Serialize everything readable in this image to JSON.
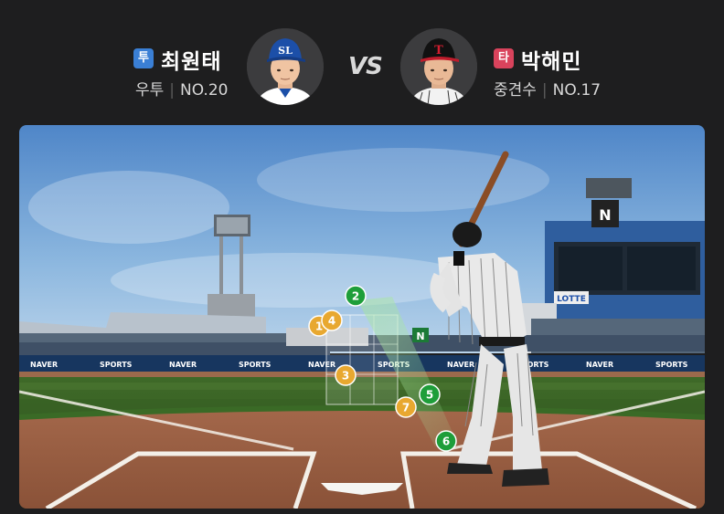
{
  "pitcher": {
    "role_badge": "투",
    "name": "최원태",
    "handedness": "우투",
    "number": "NO.20",
    "badge_color": "#3a7fd5",
    "team_logo_text": "SL"
  },
  "vs_label": "VS",
  "batter": {
    "role_badge": "타",
    "name": "박해민",
    "position": "중견수",
    "number": "NO.17",
    "badge_color": "#d9435c",
    "team_logo_text": "T"
  },
  "field": {
    "wall_ads": [
      "NAVER",
      "SPORTS",
      "NAVER",
      "SPORTS",
      "NAVER",
      "SPORTS",
      "NAVER",
      "SPORTS",
      "NAVER",
      "SPORTS"
    ],
    "scoreboard_logo": "N",
    "center_sign": "N",
    "scoreboard_brand": "LOTTE"
  },
  "pitches": [
    {
      "label": "1",
      "result": "ball",
      "color": "#e8a830"
    },
    {
      "label": "2",
      "result": "strike",
      "color": "#1e9e3a"
    },
    {
      "label": "3",
      "result": "ball",
      "color": "#e8a830"
    },
    {
      "label": "4",
      "result": "ball",
      "color": "#e8a830"
    },
    {
      "label": "5",
      "result": "strike",
      "color": "#1e9e3a"
    },
    {
      "label": "6",
      "result": "strike",
      "color": "#1e9e3a"
    },
    {
      "label": "7",
      "result": "ball",
      "color": "#e8a830"
    }
  ]
}
